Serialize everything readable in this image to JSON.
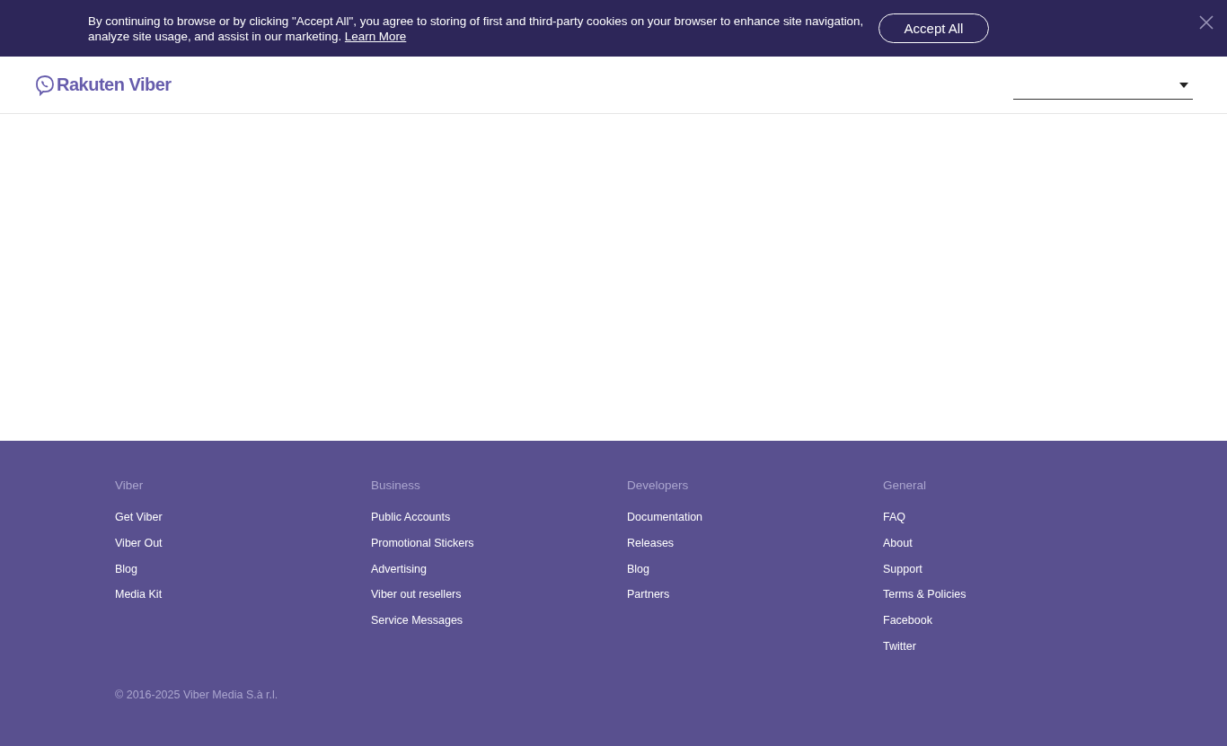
{
  "cookie_banner": {
    "text": "By continuing to browse or by clicking \"Accept All\", you agree to storing of first and third-party cookies on your browser to enhance site navigation, analyze site usage, and assist in our marketing.",
    "link": "Learn More",
    "button": "Accept All"
  },
  "header": {
    "logo": "Rakuten Viber"
  },
  "footer": {
    "columns": [
      {
        "heading": "Viber",
        "links": [
          "Get Viber",
          "Viber Out",
          "Blog",
          "Media Kit"
        ]
      },
      {
        "heading": "Business",
        "links": [
          "Public Accounts",
          "Promotional Stickers",
          "Advertising",
          "Viber out resellers",
          "Service Messages"
        ]
      },
      {
        "heading": "Developers",
        "links": [
          "Documentation",
          "Releases",
          "Blog",
          "Partners"
        ]
      },
      {
        "heading": "General",
        "links": [
          "FAQ",
          "About",
          "Support",
          "Terms & Policies",
          "Facebook",
          "Twitter"
        ]
      }
    ],
    "copyright": "© 2016-2025 Viber Media S.à r.l."
  }
}
